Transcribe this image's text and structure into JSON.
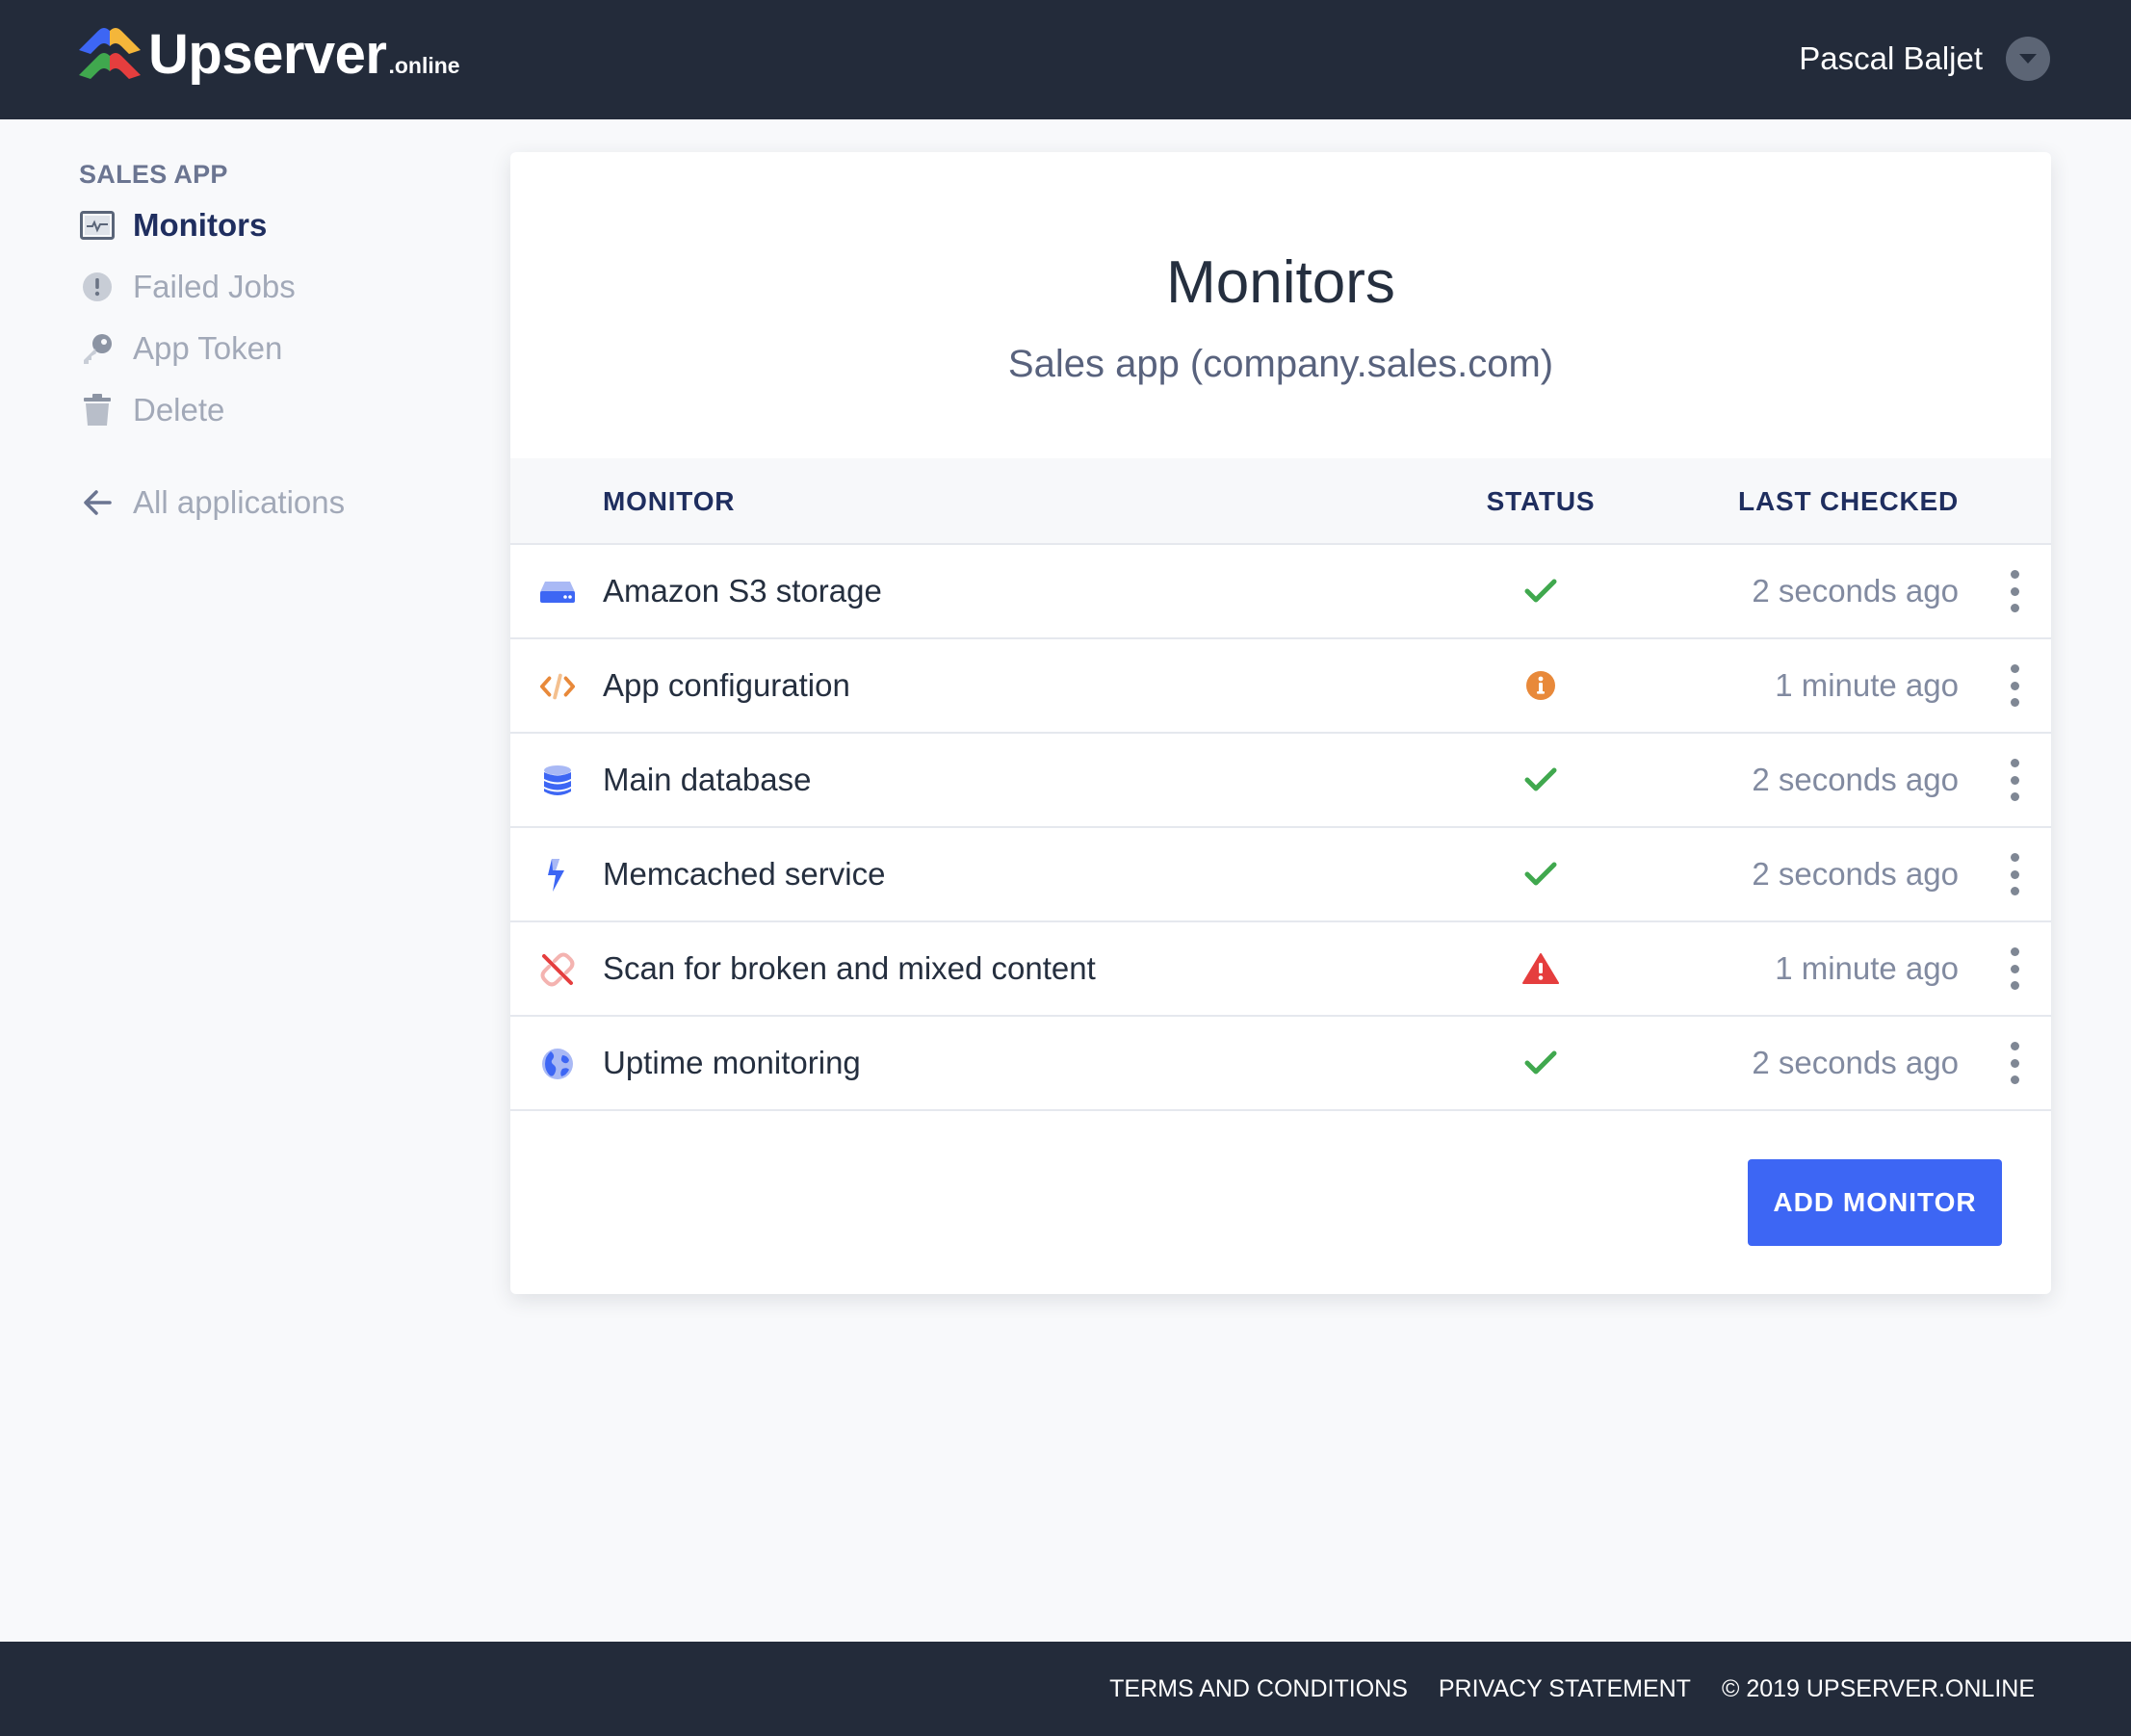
{
  "header": {
    "logo_text": "Upserver",
    "logo_suffix": ".online",
    "user_name": "Pascal Baljet"
  },
  "sidebar": {
    "heading": "SALES APP",
    "items": [
      {
        "label": "Monitors",
        "icon": "monitor-icon",
        "active": true
      },
      {
        "label": "Failed Jobs",
        "icon": "exclamation-circle-icon"
      },
      {
        "label": "App Token",
        "icon": "key-icon"
      },
      {
        "label": "Delete",
        "icon": "trash-icon"
      }
    ],
    "back_label": "All applications"
  },
  "main": {
    "title": "Monitors",
    "subtitle": "Sales app (company.sales.com)",
    "columns": [
      "MONITOR",
      "STATUS",
      "LAST CHECKED"
    ],
    "rows": [
      {
        "name": "Amazon S3 storage",
        "icon": "storage-drive-icon",
        "status": "ok",
        "last_checked": "2 seconds ago"
      },
      {
        "name": "App configuration",
        "icon": "code-icon",
        "status": "info",
        "last_checked": "1 minute ago"
      },
      {
        "name": "Main database",
        "icon": "database-icon",
        "status": "ok",
        "last_checked": "2 seconds ago"
      },
      {
        "name": "Memcached service",
        "icon": "lightning-bolt-icon",
        "status": "ok",
        "last_checked": "2 seconds ago"
      },
      {
        "name": "Scan for broken and mixed content",
        "icon": "broken-link-icon",
        "status": "error",
        "last_checked": "1 minute ago"
      },
      {
        "name": "Uptime monitoring",
        "icon": "globe-icon",
        "status": "ok",
        "last_checked": "2 seconds ago"
      }
    ],
    "add_button": "ADD MONITOR"
  },
  "footer": {
    "terms": "TERMS AND CONDITIONS",
    "privacy": "PRIVACY STATEMENT",
    "copyright": "© 2019 UPSERVER.ONLINE"
  },
  "colors": {
    "header_bg": "#232b3a",
    "accent": "#3d66f4",
    "active_nav": "#1f2e5f",
    "status_ok": "#40a84e",
    "status_info": "#e8893a",
    "status_error": "#e53e3e"
  }
}
